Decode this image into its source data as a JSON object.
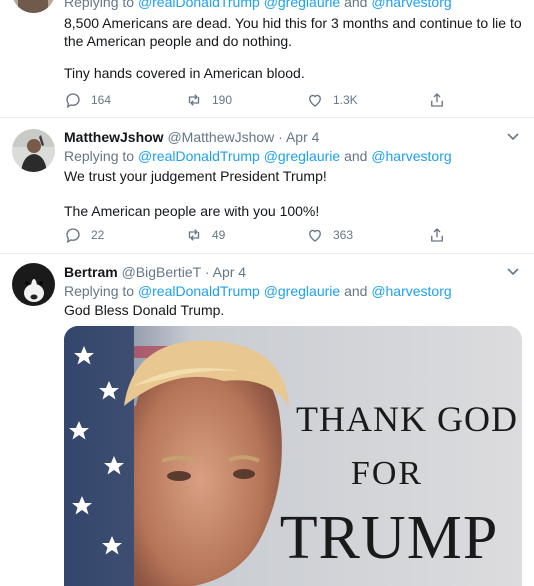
{
  "tweets": [
    {
      "reply_prefix": "Replying to ",
      "reply_users": [
        "@realDonaldTrump",
        "@greglaurie",
        "@harvestorg"
      ],
      "reply_and": "and",
      "text_lines": [
        "8,500 Americans are dead.  You hid this for 3 months and continue to lie to",
        "the American people and do nothing."
      ],
      "text2": "Tiny hands covered in American blood.",
      "replies": "164",
      "retweets": "190",
      "likes": "1.3K"
    },
    {
      "name": "MatthewJshow",
      "handle": "@MatthewJshow",
      "date": "Apr 4",
      "reply_prefix": "Replying to ",
      "reply_users": [
        "@realDonaldTrump",
        "@greglaurie",
        "@harvestorg"
      ],
      "reply_and": "and",
      "text": "We trust your judgement President Trump!",
      "text2": "The American people are with you 100%!",
      "replies": "22",
      "retweets": "49",
      "likes": "363"
    },
    {
      "name": "Bertram",
      "handle": "@BigBertieT",
      "date": "Apr 4",
      "reply_prefix": "Replying to ",
      "reply_users": [
        "@realDonaldTrump",
        "@greglaurie",
        "@harvestorg"
      ],
      "reply_and": "and",
      "text": "God Bless Donald Trump.",
      "image_lines": [
        "THANK GOD",
        "FOR",
        "TRUMP"
      ]
    }
  ],
  "separator": "·",
  "colors": {
    "link": "#1da1f2",
    "muted": "#657786",
    "text": "#14171a",
    "border": "#e6ecf0"
  },
  "icons": [
    "reply-icon",
    "retweet-icon",
    "like-icon",
    "share-icon",
    "chevron-down-icon"
  ]
}
